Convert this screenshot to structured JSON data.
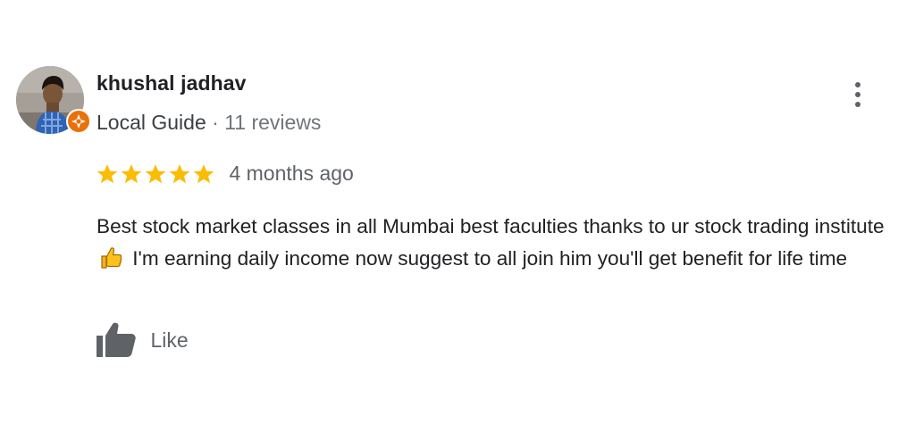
{
  "review": {
    "author_name": "khushal jadhav",
    "guide_label": "Local Guide",
    "separator": "·",
    "review_count": "11 reviews",
    "rating": 5,
    "rating_max": 5,
    "date": "4 months ago",
    "text_before_emoji": "Best stock market classes in all Mumbai best faculties thanks to ur stock trading institute ",
    "text_after_emoji": " I'm earning daily income now suggest to all join him you'll get benefit for life time",
    "like_label": "Like"
  },
  "icons": {
    "more": "more-vert-icon",
    "star": "star-icon",
    "emoji": "thumbs-up-emoji",
    "like": "thumb-up-icon",
    "badge": "local-guide-badge-icon"
  },
  "colors": {
    "star": "#fbbc04",
    "badge": "#e8710a",
    "name": "#202124",
    "meta": "#70757a",
    "text": "#202124",
    "icon": "#5f6368"
  }
}
